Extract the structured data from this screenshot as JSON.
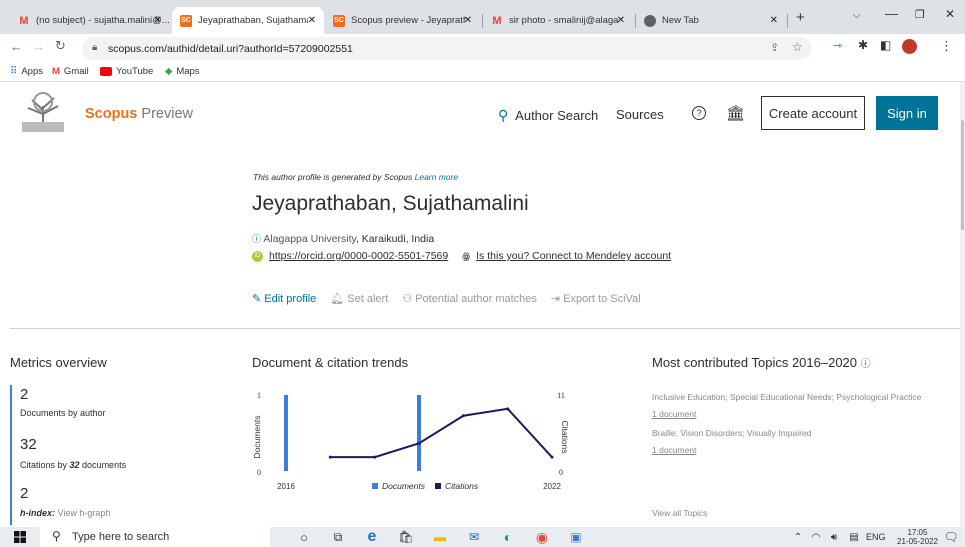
{
  "browser": {
    "tabs": [
      {
        "label": "(no subject) - sujatha.malini@...",
        "favicon": "M",
        "color": "#ea4335"
      },
      {
        "label": "Jeyaprathaban, Sujathamalini",
        "favicon": "SC",
        "color": "#f36d21"
      },
      {
        "label": "Scopus preview - Jeyaprathal...",
        "favicon": "SC",
        "color": "#f36d21"
      },
      {
        "label": "sir photo - smalinij@alagapp...",
        "favicon": "M",
        "color": "#ea4335"
      },
      {
        "label": "New Tab",
        "favicon": "◉",
        "color": "#5f6368"
      }
    ],
    "url": "scopus.com/authid/detail.uri?authorId=57209002551",
    "bookmarks": [
      "Apps",
      "Gmail",
      "YouTube",
      "Maps"
    ]
  },
  "header": {
    "brand": "Scopus",
    "brand_suffix": "Preview",
    "author_search": "Author Search",
    "sources": "Sources",
    "create_account": "Create account",
    "sign_in": "Sign in"
  },
  "profile": {
    "generated_note": "This author profile is generated by Scopus",
    "learn_more": "Learn more",
    "name": "Jeyaprathaban, Sujathamalini",
    "affiliation": "Alagappa University",
    "location": ", Karaikudi, India",
    "orcid": "https://orcid.org/0000-0002-5501-7569",
    "mendeley": "Is this you? Connect to Mendeley account",
    "actions": {
      "edit": "Edit profile",
      "alert": "Set alert",
      "matches": "Potential author matches",
      "export": "Export to SciVal"
    }
  },
  "metrics": {
    "title": "Metrics overview",
    "docs_value": "2",
    "docs_label": "Documents by author",
    "cites_value": "32",
    "cites_label_pre": "Citations by ",
    "cites_label_num": "32",
    "cites_label_post": " documents",
    "h_value": "2",
    "h_label": "h-index:",
    "h_link": "View h-graph"
  },
  "trends": {
    "title": "Document & citation trends",
    "legend_docs": "Documents",
    "legend_cites": "Citations"
  },
  "chart_data": {
    "type": "bar",
    "x_start": "2016",
    "x_end": "2022",
    "ylabel": "Documents",
    "ylabel_right": "Citations",
    "y_left_ticks": [
      "0",
      "1"
    ],
    "y_right_ticks": [
      "0",
      "11"
    ],
    "ylim": [
      0,
      1
    ],
    "ylim_right": [
      0,
      11
    ],
    "series": [
      {
        "name": "Documents",
        "type": "bar",
        "x": [
          2016,
          2019
        ],
        "values": [
          1,
          1
        ],
        "color": "#3b7ddd"
      },
      {
        "name": "Citations",
        "type": "line",
        "x": [
          2017,
          2018,
          2019,
          2020,
          2021,
          2022
        ],
        "values": [
          2,
          2,
          4,
          8,
          9,
          2
        ],
        "color": "#1a1a5e"
      }
    ]
  },
  "topics": {
    "title": "Most contributed Topics 2016–2020",
    "items": [
      {
        "name": "Inclusive Education; Special Educational Needs; Psychological Practice",
        "count": "1 document"
      },
      {
        "name": "Braille; Vision Disorders; Visually Impaired",
        "count": "1 document"
      }
    ],
    "view_all": "View all Topics"
  },
  "taskbar": {
    "search_placeholder": "Type here to search",
    "lang": "ENG",
    "time": "17:05",
    "date": "21-05-2022"
  }
}
